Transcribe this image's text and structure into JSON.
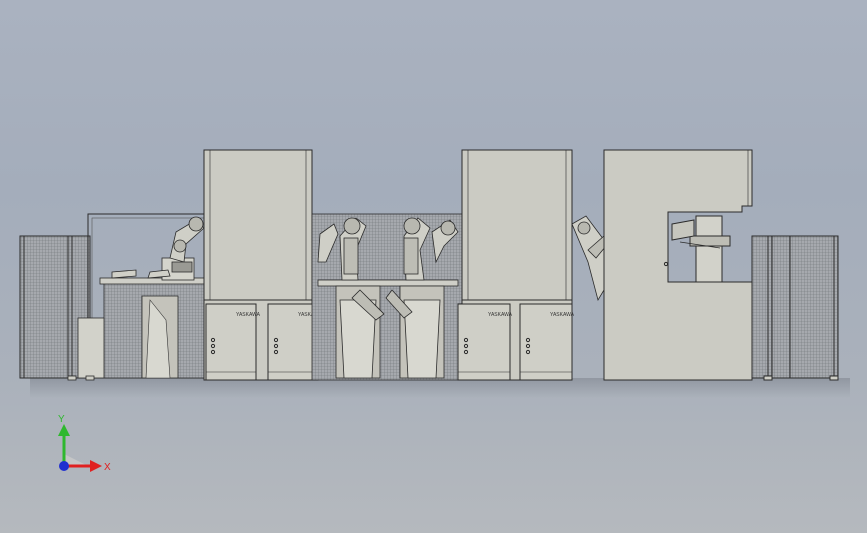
{
  "viewport": {
    "background_top": "#aab2c0",
    "background_bottom": "#b5b9be"
  },
  "model": {
    "cabinet_brand": "YASKAWA",
    "colors": {
      "body": "#cbcbc3",
      "outline": "#2b2b2b",
      "mesh": "#8e9298",
      "pedestal": "#c4c3bb"
    }
  },
  "triad": {
    "x_label": "X",
    "y_label": "Y",
    "x_color": "#e02020",
    "y_color": "#2eb82e",
    "z_color": "#2030d0"
  }
}
